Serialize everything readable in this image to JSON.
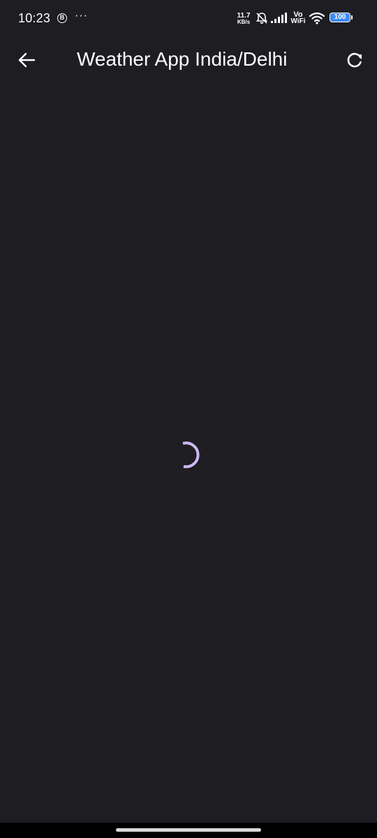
{
  "status_bar": {
    "time": "10:23",
    "b_badge": "B",
    "more_dots": "···",
    "net_speed_value": "11.7",
    "net_speed_unit": "KB/s",
    "vo_label": "Vo",
    "wifi_label": "WiFi",
    "battery_level": "100",
    "icons": [
      "b-badge-icon",
      "bell-off-icon",
      "signal-icon",
      "wifi-icon",
      "battery-icon"
    ]
  },
  "app_bar": {
    "title": "Weather App India/Delhi",
    "back_icon": "arrow-left-icon",
    "refresh_icon": "refresh-icon"
  },
  "loading": {
    "indicator": "circular-progress-spinner"
  },
  "colors": {
    "background": "#1e1d22",
    "spinner_accent": "#cdb8f5",
    "text": "#ffffff",
    "battery_fill": "#3d8cf5",
    "nav_bar": "#000000"
  }
}
